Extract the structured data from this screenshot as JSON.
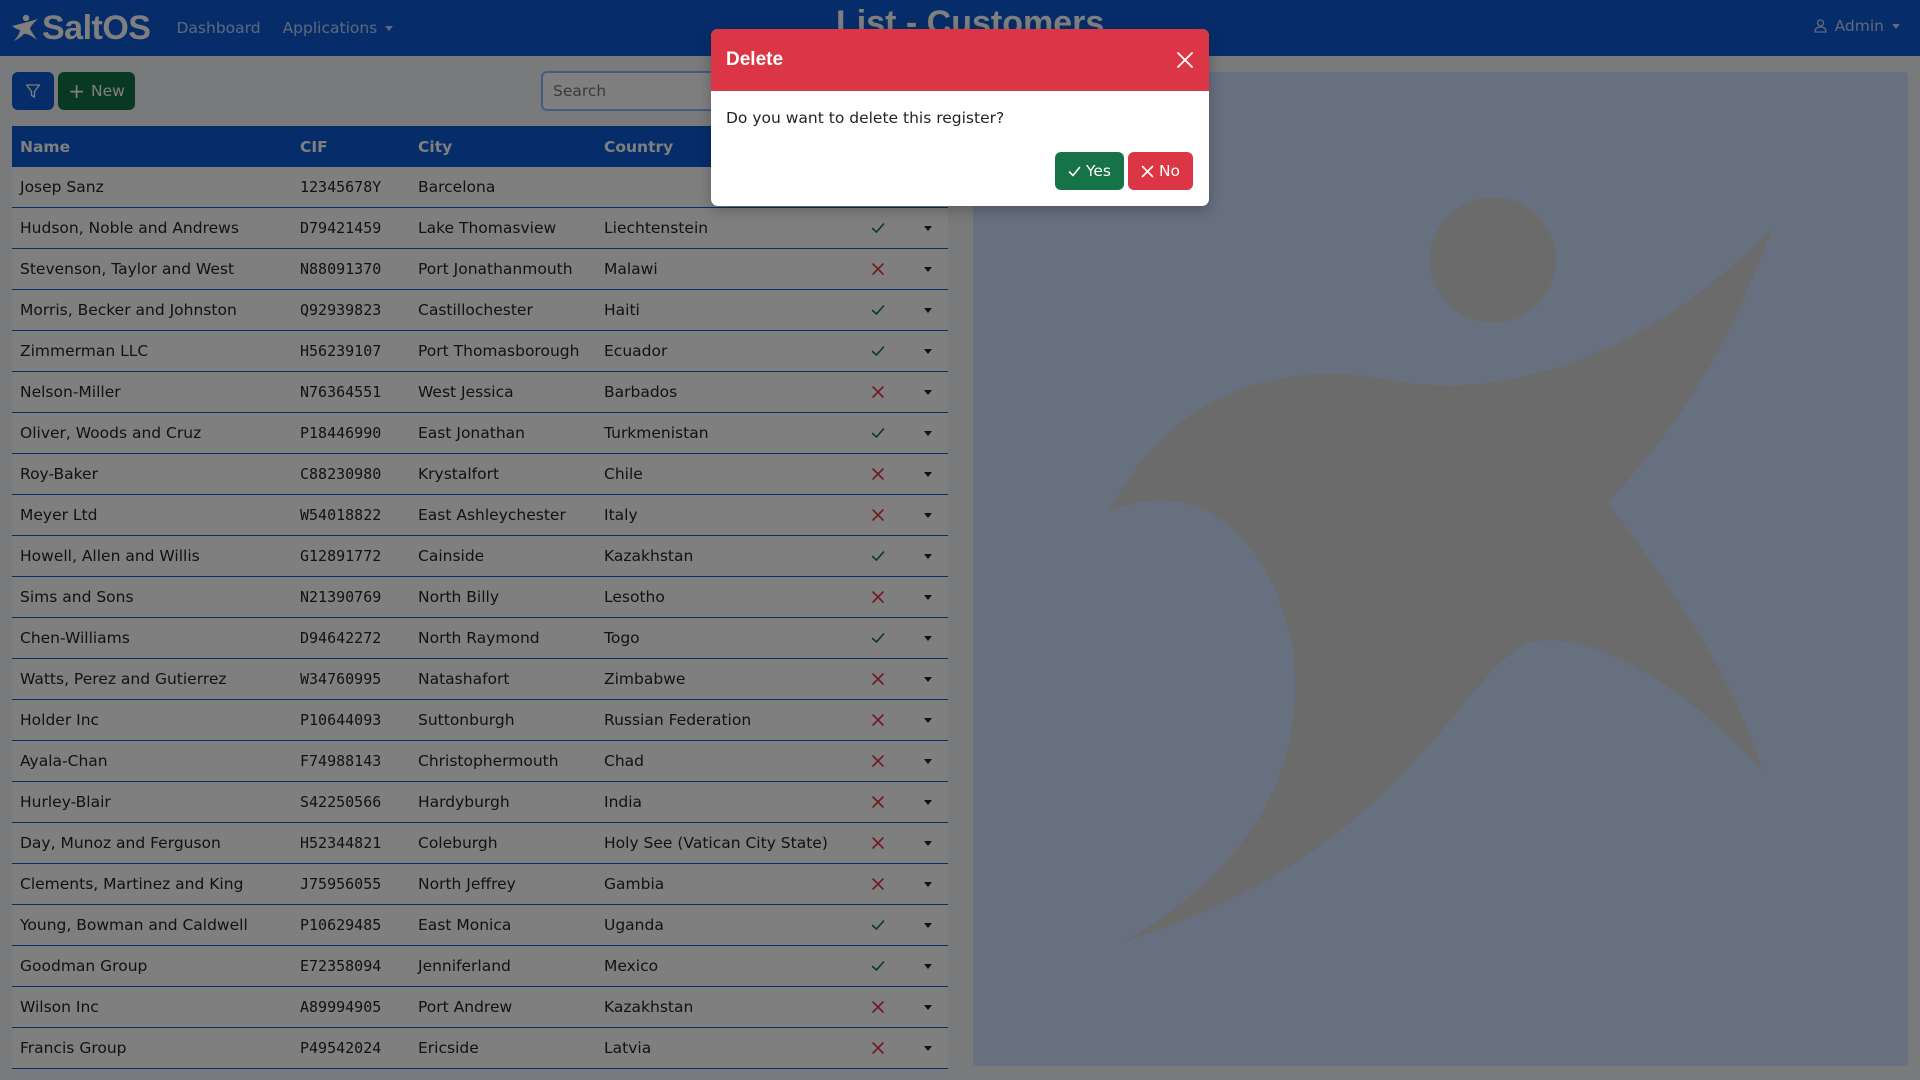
{
  "navbar": {
    "brand": "SaltOS",
    "links": [
      "Dashboard",
      "Applications"
    ],
    "title": "List - Customers",
    "user": "Admin"
  },
  "toolbar": {
    "new_label": "New",
    "search_placeholder": "Search"
  },
  "table": {
    "columns": [
      "Name",
      "CIF",
      "City",
      "Country"
    ],
    "rows": [
      {
        "name": "Josep Sanz",
        "cif": "12345678Y",
        "city": "Barcelona",
        "country": "",
        "active": null
      },
      {
        "name": "Hudson, Noble and Andrews",
        "cif": "D79421459",
        "city": "Lake Thomasview",
        "country": "Liechtenstein",
        "active": true
      },
      {
        "name": "Stevenson, Taylor and West",
        "cif": "N88091370",
        "city": "Port Jonathanmouth",
        "country": "Malawi",
        "active": false
      },
      {
        "name": "Morris, Becker and Johnston",
        "cif": "Q92939823",
        "city": "Castillochester",
        "country": "Haiti",
        "active": true
      },
      {
        "name": "Zimmerman LLC",
        "cif": "H56239107",
        "city": "Port Thomasborough",
        "country": "Ecuador",
        "active": true
      },
      {
        "name": "Nelson-Miller",
        "cif": "N76364551",
        "city": "West Jessica",
        "country": "Barbados",
        "active": false
      },
      {
        "name": "Oliver, Woods and Cruz",
        "cif": "P18446990",
        "city": "East Jonathan",
        "country": "Turkmenistan",
        "active": true
      },
      {
        "name": "Roy-Baker",
        "cif": "C88230980",
        "city": "Krystalfort",
        "country": "Chile",
        "active": false
      },
      {
        "name": "Meyer Ltd",
        "cif": "W54018822",
        "city": "East Ashleychester",
        "country": "Italy",
        "active": false
      },
      {
        "name": "Howell, Allen and Willis",
        "cif": "G12891772",
        "city": "Cainside",
        "country": "Kazakhstan",
        "active": true
      },
      {
        "name": "Sims and Sons",
        "cif": "N21390769",
        "city": "North Billy",
        "country": "Lesotho",
        "active": false
      },
      {
        "name": "Chen-Williams",
        "cif": "D94642272",
        "city": "North Raymond",
        "country": "Togo",
        "active": true
      },
      {
        "name": "Watts, Perez and Gutierrez",
        "cif": "W34760995",
        "city": "Natashafort",
        "country": "Zimbabwe",
        "active": false
      },
      {
        "name": "Holder Inc",
        "cif": "P10644093",
        "city": "Suttonburgh",
        "country": "Russian Federation",
        "active": false
      },
      {
        "name": "Ayala-Chan",
        "cif": "F74988143",
        "city": "Christophermouth",
        "country": "Chad",
        "active": false
      },
      {
        "name": "Hurley-Blair",
        "cif": "S42250566",
        "city": "Hardyburgh",
        "country": "India",
        "active": false
      },
      {
        "name": "Day, Munoz and Ferguson",
        "cif": "H52344821",
        "city": "Coleburgh",
        "country": "Holy See (Vatican City State)",
        "active": false
      },
      {
        "name": "Clements, Martinez and King",
        "cif": "J75956055",
        "city": "North Jeffrey",
        "country": "Gambia",
        "active": false
      },
      {
        "name": "Young, Bowman and Caldwell",
        "cif": "P10629485",
        "city": "East Monica",
        "country": "Uganda",
        "active": true
      },
      {
        "name": "Goodman Group",
        "cif": "E72358094",
        "city": "Jenniferland",
        "country": "Mexico",
        "active": true
      },
      {
        "name": "Wilson Inc",
        "cif": "A89994905",
        "city": "Port Andrew",
        "country": "Kazakhstan",
        "active": false
      },
      {
        "name": "Francis Group",
        "cif": "P49542024",
        "city": "Ericside",
        "country": "Latvia",
        "active": false
      }
    ]
  },
  "modal": {
    "title": "Delete",
    "message": "Do you want to delete this register?",
    "yes_label": "Yes",
    "no_label": "No"
  },
  "colors": {
    "primary": "#0d5ad4",
    "success": "#157347",
    "danger": "#dc3545"
  }
}
